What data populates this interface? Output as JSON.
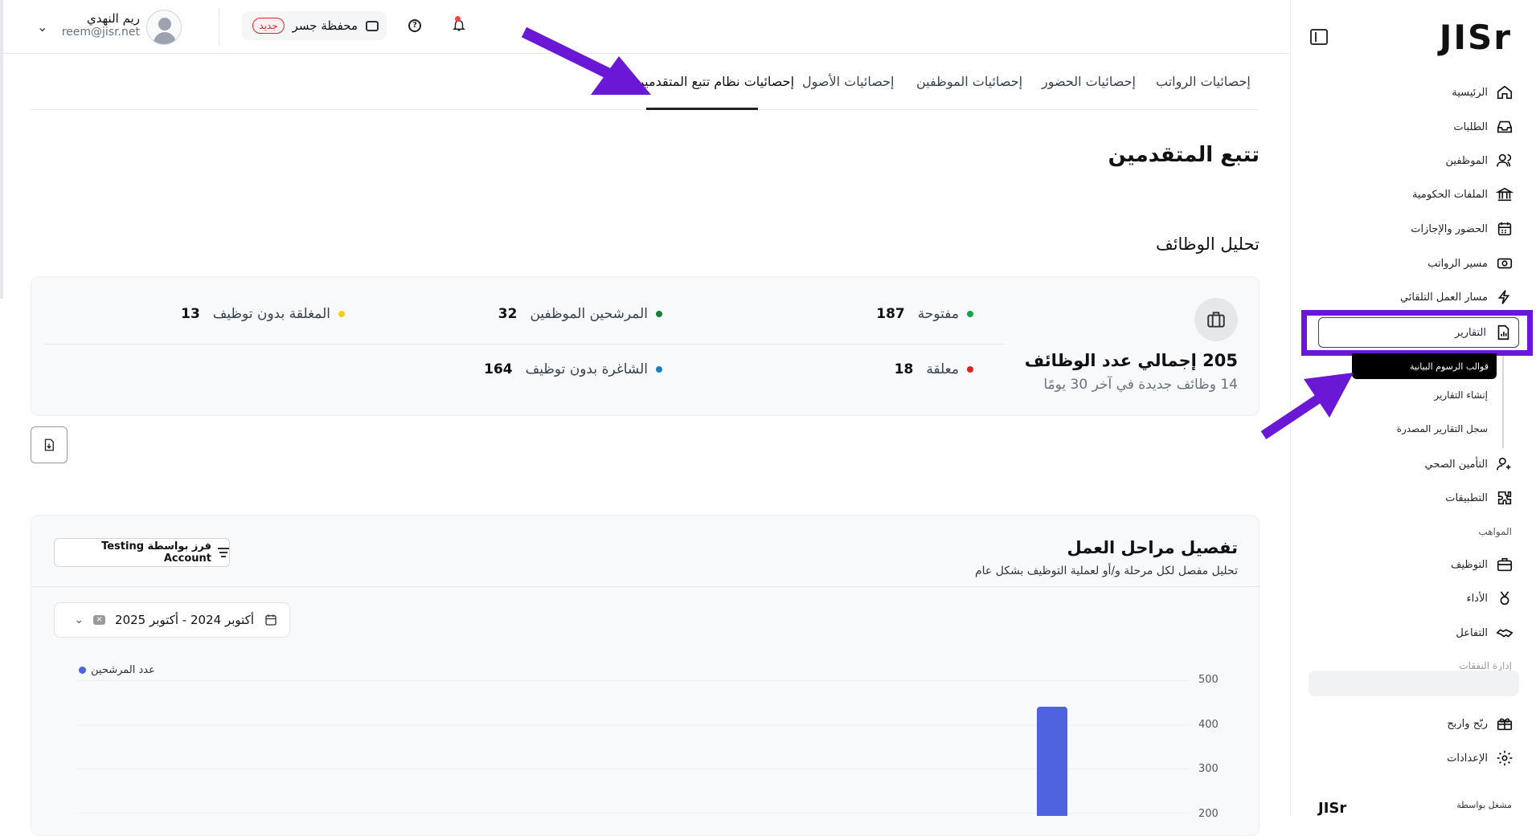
{
  "user": {
    "name": "ريم النهدي",
    "email": "reem@jisr.net"
  },
  "wallet": {
    "label": "محفظة جسر",
    "badge": "جديد"
  },
  "tabs": [
    {
      "label": "إحصائيات الرواتب"
    },
    {
      "label": "إحصائيات الحضور"
    },
    {
      "label": "إحصائيات الموظفين"
    },
    {
      "label": "إحصائيات الأصول"
    },
    {
      "label": "إحصائيات نظام تتبع المتقدمين",
      "active": true
    }
  ],
  "page_title": "تتبع المتقدمين",
  "section_title": "تحليل الوظائف",
  "jobs_card": {
    "total_label": "205 إجمالي عدد الوظائف",
    "subtitle": "14 وظائف جديدة في آخر 30 يومًا",
    "stats": [
      {
        "label": "مفتوحة",
        "value": "187",
        "color": "#16a34a"
      },
      {
        "label": "المرشحين الموظفين",
        "value": "32",
        "color": "#15803d"
      },
      {
        "label": "المغلقة بدون توظيف",
        "value": "13",
        "color": "#facc15"
      },
      {
        "label": "معلقة",
        "value": "18",
        "color": "#dc2626"
      },
      {
        "label": "الشاغرة بدون توظيف",
        "value": "164",
        "color": "#1d7fc0"
      }
    ]
  },
  "pipeline": {
    "title": "تفصيل مراحل العمل",
    "subtitle": "تحليل مفصل لكل مرحلة و/أو لعملية التوظيف بشكل عام",
    "sort_button": "فرز بواسطة Testing Account",
    "date_range": "أكتوبر 2024 - أكتوبر 2025"
  },
  "chart_data": {
    "type": "bar",
    "legend": [
      "عدد المرشحين"
    ],
    "y_ticks": [
      "500",
      "400",
      "300",
      "200"
    ],
    "ylim": [
      0,
      500
    ],
    "series": [
      {
        "name": "عدد المرشحين",
        "values": [
          440
        ]
      }
    ],
    "color": "#4f63e0"
  },
  "sidebar": {
    "logo": "JISr",
    "items": [
      {
        "label": "الرئيسية",
        "icon": "home-icon"
      },
      {
        "label": "الطلبات",
        "icon": "inbox-icon"
      },
      {
        "label": "الموظفين",
        "icon": "users-icon"
      },
      {
        "label": "الملفات الحكومية",
        "icon": "bank-icon"
      },
      {
        "label": "الحضور والإجازات",
        "icon": "calendar-icon"
      },
      {
        "label": "مسير الرواتب",
        "icon": "money-icon"
      },
      {
        "label": "مسار العمل التلقائي",
        "icon": "automation-icon"
      },
      {
        "label": "التقارير",
        "icon": "report-icon"
      }
    ],
    "report_subitems": [
      {
        "label": "قوالب الرسوم البيانية"
      },
      {
        "label": "إنشاء التقارير"
      },
      {
        "label": "سجل التقارير المصدرة"
      }
    ],
    "items2": [
      {
        "label": "التأمين الصحي",
        "icon": "health-icon"
      },
      {
        "label": "التطبيقات",
        "icon": "puzzle-icon"
      }
    ],
    "section_talent": "المواهب",
    "talent_items": [
      {
        "label": "التوظيف",
        "icon": "briefcase-icon"
      },
      {
        "label": "الأداء",
        "icon": "medal-icon"
      },
      {
        "label": "التفاعل",
        "icon": "handshake-icon"
      }
    ],
    "section_spend": "إدارة النفقات",
    "bottom_items": [
      {
        "label": "ربّح واربح",
        "icon": "gift-icon"
      },
      {
        "label": "الإعدادات",
        "icon": "gear-icon"
      }
    ],
    "powered_by": "مشغل بواسطة",
    "powered_logo": "JISr"
  }
}
